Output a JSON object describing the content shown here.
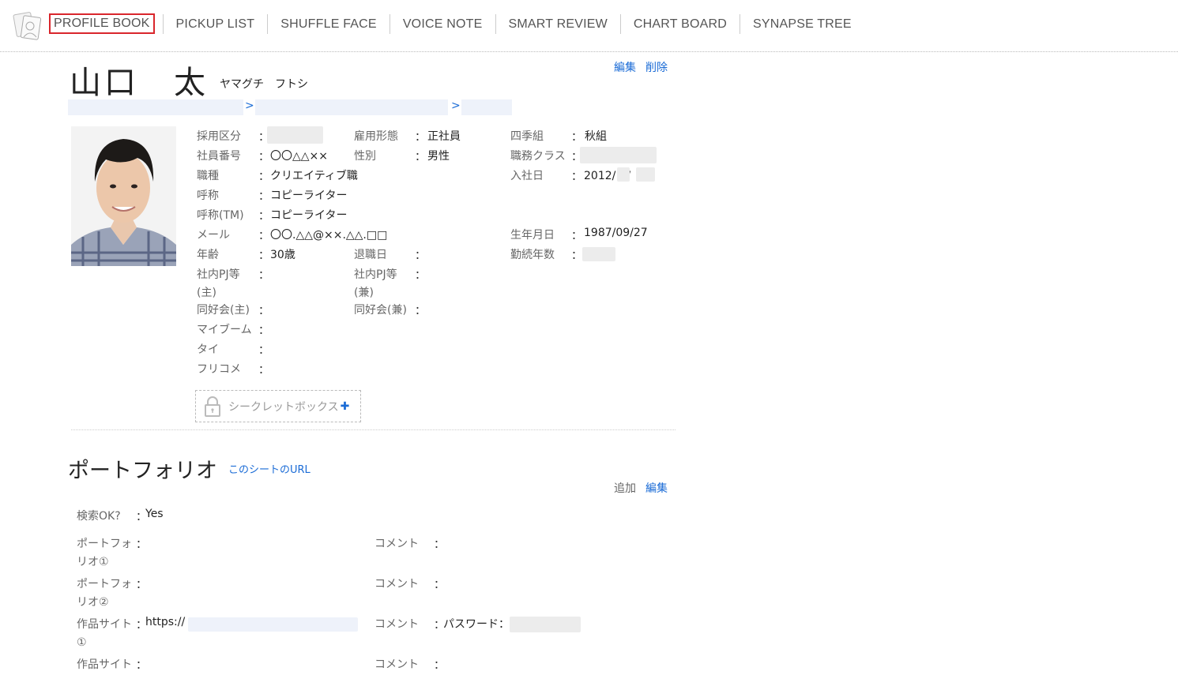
{
  "nav": {
    "items": [
      "PROFILE BOOK",
      "PICKUP LIST",
      "SHUFFLE FACE",
      "VOICE NOTE",
      "SMART REVIEW",
      "CHART BOARD",
      "SYNAPSE TREE"
    ]
  },
  "profile": {
    "name": "山口　太",
    "kana": "ヤマグチ　フトシ",
    "actions": {
      "edit": "編集",
      "delete": "削除"
    },
    "breadcrumb_sep": ">"
  },
  "fields": {
    "saiyo": {
      "label": "採用区分"
    },
    "koyo": {
      "label": "雇用形態",
      "value": "正社員"
    },
    "shiki": {
      "label": "四季組",
      "value": "秋組"
    },
    "shain": {
      "label": "社員番号",
      "value": "〇〇△△××"
    },
    "seibetsu": {
      "label": "性別",
      "value": "男性"
    },
    "shokumu": {
      "label": "職務クラス"
    },
    "shokushu": {
      "label": "職種",
      "value": "クリエイティブ職"
    },
    "nyusha": {
      "label": "入社日",
      "value": "2012/　/"
    },
    "kosho": {
      "label": "呼称",
      "value": "コピーライター"
    },
    "kosho_tm": {
      "label": "呼称(TM)",
      "value": "コピーライター"
    },
    "mail": {
      "label": "メール",
      "value": "〇〇.△△@××.△△.□□"
    },
    "birthday": {
      "label": "生年月日",
      "value": "1987/09/27"
    },
    "age": {
      "label": "年齢",
      "value": "30歳"
    },
    "taishoku": {
      "label": "退職日"
    },
    "kinzoku": {
      "label": "勤続年数"
    },
    "pj_main": {
      "label": "社内PJ等(主)"
    },
    "pj_sub": {
      "label": "社内PJ等(兼)"
    },
    "club_main": {
      "label": "同好会(主)"
    },
    "club_sub": {
      "label": "同好会(兼)"
    },
    "myboom": {
      "label": "マイブーム"
    },
    "tai": {
      "label": "タイ"
    },
    "free": {
      "label": "フリコメ"
    }
  },
  "colon": "：",
  "secret": {
    "label": "シークレットボックス",
    "plus": "✚"
  },
  "portfolio": {
    "title": "ポートフォリオ",
    "url_link": "このシートのURL",
    "add": "追加",
    "edit": "編集",
    "search_ok": {
      "label": "検索OK?",
      "value": "Yes"
    },
    "rows": [
      {
        "label": "ポートフォリオ①",
        "comment": "コメント",
        "value": "",
        "comment_value": ""
      },
      {
        "label": "ポートフォリオ②",
        "comment": "コメント",
        "value": "",
        "comment_value": ""
      },
      {
        "label": "作品サイト①",
        "comment": "コメント",
        "value": "https://",
        "comment_value": "パスワード："
      },
      {
        "label": "作品サイト",
        "comment": "コメント",
        "value": "",
        "comment_value": ""
      }
    ]
  }
}
